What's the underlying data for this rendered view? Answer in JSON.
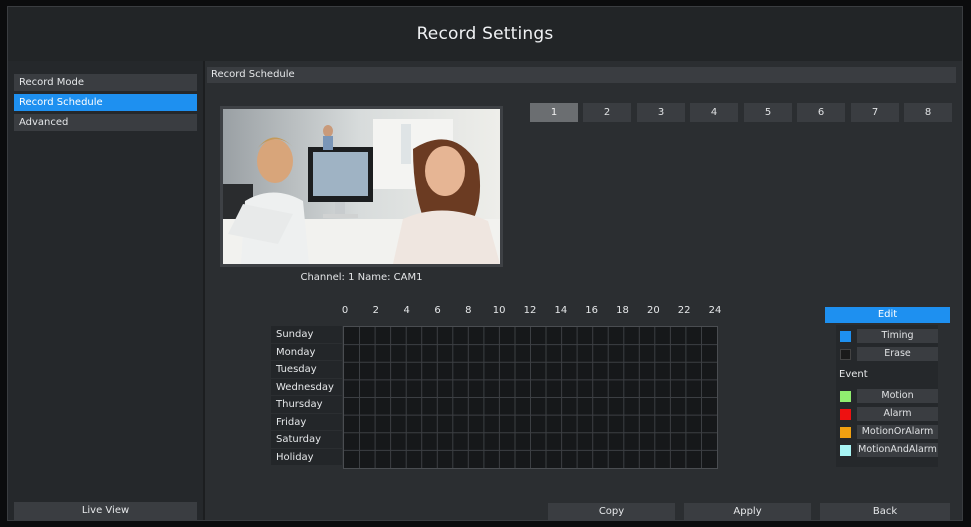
{
  "window": {
    "title": "Record Settings"
  },
  "sidebar": {
    "items": [
      {
        "label": "Record Mode",
        "active": false
      },
      {
        "label": "Record Schedule",
        "active": true
      },
      {
        "label": "Advanced",
        "active": false
      }
    ],
    "live_view_label": "Live View"
  },
  "main": {
    "section_title": "Record Schedule",
    "channel_caption": "Channel: 1 Name: CAM1",
    "channels": [
      "1",
      "2",
      "3",
      "4",
      "5",
      "6",
      "7",
      "8"
    ],
    "selected_channel": "1"
  },
  "schedule": {
    "hours": [
      "0",
      "2",
      "4",
      "6",
      "8",
      "10",
      "12",
      "14",
      "16",
      "18",
      "20",
      "22",
      "24"
    ],
    "days": [
      "Sunday",
      "Monday",
      "Tuesday",
      "Wednesday",
      "Thursday",
      "Friday",
      "Saturday",
      "Holiday"
    ]
  },
  "legend": {
    "edit_label": "Edit",
    "timing_label": "Timing",
    "erase_label": "Erase",
    "event_label": "Event",
    "motion_label": "Motion",
    "alarm_label": "Alarm",
    "motion_or_alarm_label": "MotionOrAlarm",
    "motion_and_alarm_label": "MotionAndAlarm",
    "colors": {
      "timing": "#1e90f0",
      "erase": "#1a1a1a",
      "motion": "#90ee70",
      "alarm": "#ee1111",
      "motion_or_alarm": "#f0a010",
      "motion_and_alarm": "#a8f4f4"
    }
  },
  "footer": {
    "copy_label": "Copy",
    "apply_label": "Apply",
    "back_label": "Back"
  },
  "accent_color": "#1e90f0"
}
